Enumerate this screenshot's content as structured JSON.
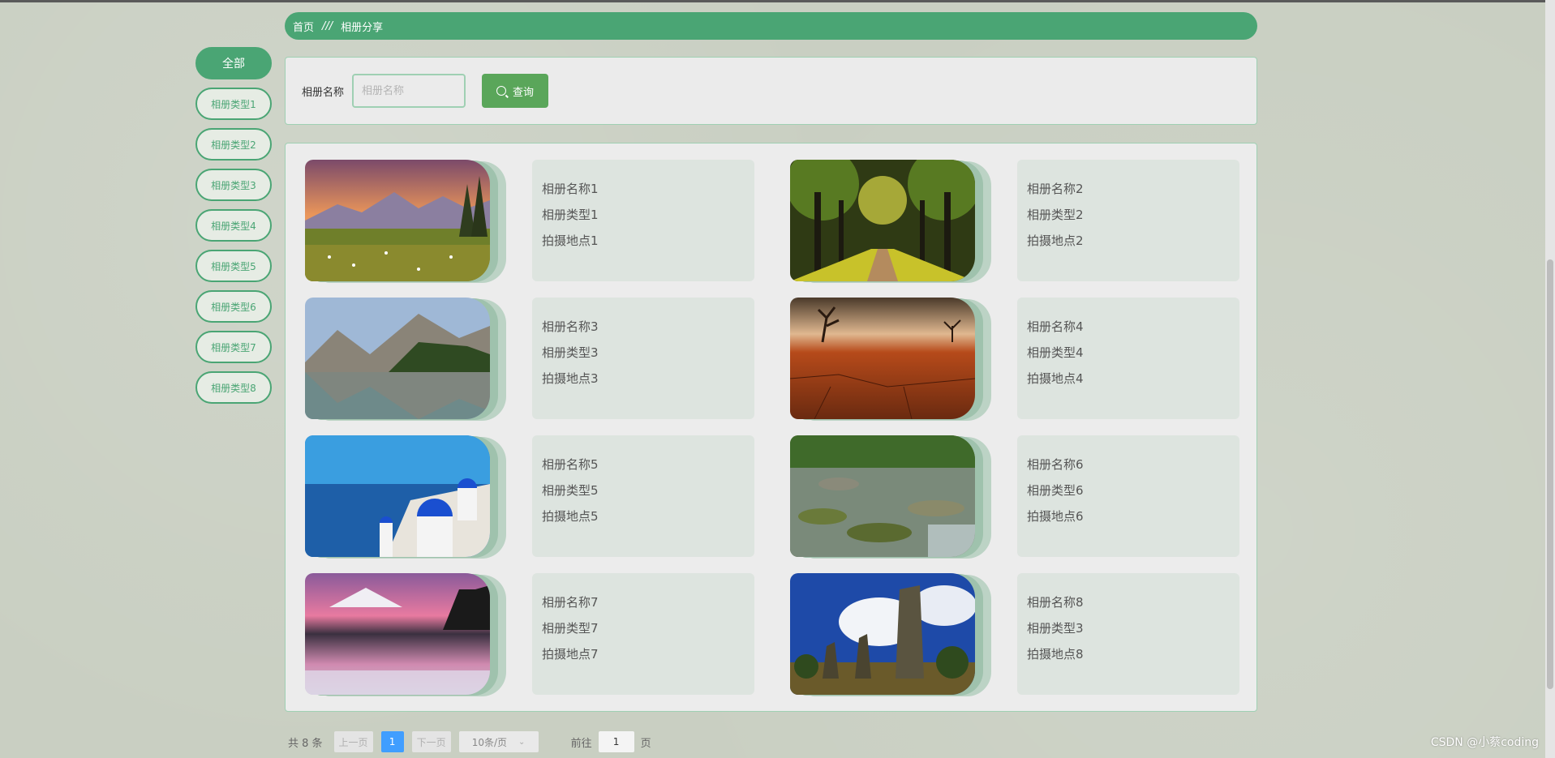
{
  "breadcrumb": {
    "home": "首页",
    "separator": "///",
    "current": "相册分享"
  },
  "sidebar": {
    "items": [
      {
        "label": "全部",
        "active": true
      },
      {
        "label": "相册类型1"
      },
      {
        "label": "相册类型2"
      },
      {
        "label": "相册类型3"
      },
      {
        "label": "相册类型4"
      },
      {
        "label": "相册类型5"
      },
      {
        "label": "相册类型6"
      },
      {
        "label": "相册类型7"
      },
      {
        "label": "相册类型8"
      }
    ]
  },
  "search": {
    "label": "相册名称",
    "placeholder": "相册名称",
    "button_label": "查询"
  },
  "albums": [
    {
      "name": "相册名称1",
      "type": "相册类型1",
      "location": "拍摄地点1",
      "image": "mountain-meadow-sunset"
    },
    {
      "name": "相册名称2",
      "type": "相册类型2",
      "location": "拍摄地点2",
      "image": "tree-lined-path"
    },
    {
      "name": "相册名称3",
      "type": "相册类型3",
      "location": "拍摄地点3",
      "image": "mountain-lake"
    },
    {
      "name": "相册名称4",
      "type": "相册类型4",
      "location": "拍摄地点4",
      "image": "cracked-desert"
    },
    {
      "name": "相册名称5",
      "type": "相册类型5",
      "location": "拍摄地点5",
      "image": "santorini-coast"
    },
    {
      "name": "相册名称6",
      "type": "相册类型6",
      "location": "拍摄地点6",
      "image": "rocky-stream"
    },
    {
      "name": "相册名称7",
      "type": "相册类型7",
      "location": "拍摄地点7",
      "image": "pink-lake-dusk"
    },
    {
      "name": "相册名称8",
      "type": "相册类型3",
      "location": "拍摄地点8",
      "image": "rock-pillars"
    }
  ],
  "pagination": {
    "total": "共 8 条",
    "prev": "上一页",
    "current_page": "1",
    "next": "下一页",
    "page_size": "10条/页",
    "goto": "前往",
    "goto_value": "1",
    "page_unit": "页"
  },
  "watermark": "CSDN @小蔡coding",
  "colors": {
    "accent": "#4aa574",
    "pager_active": "#409eff"
  }
}
